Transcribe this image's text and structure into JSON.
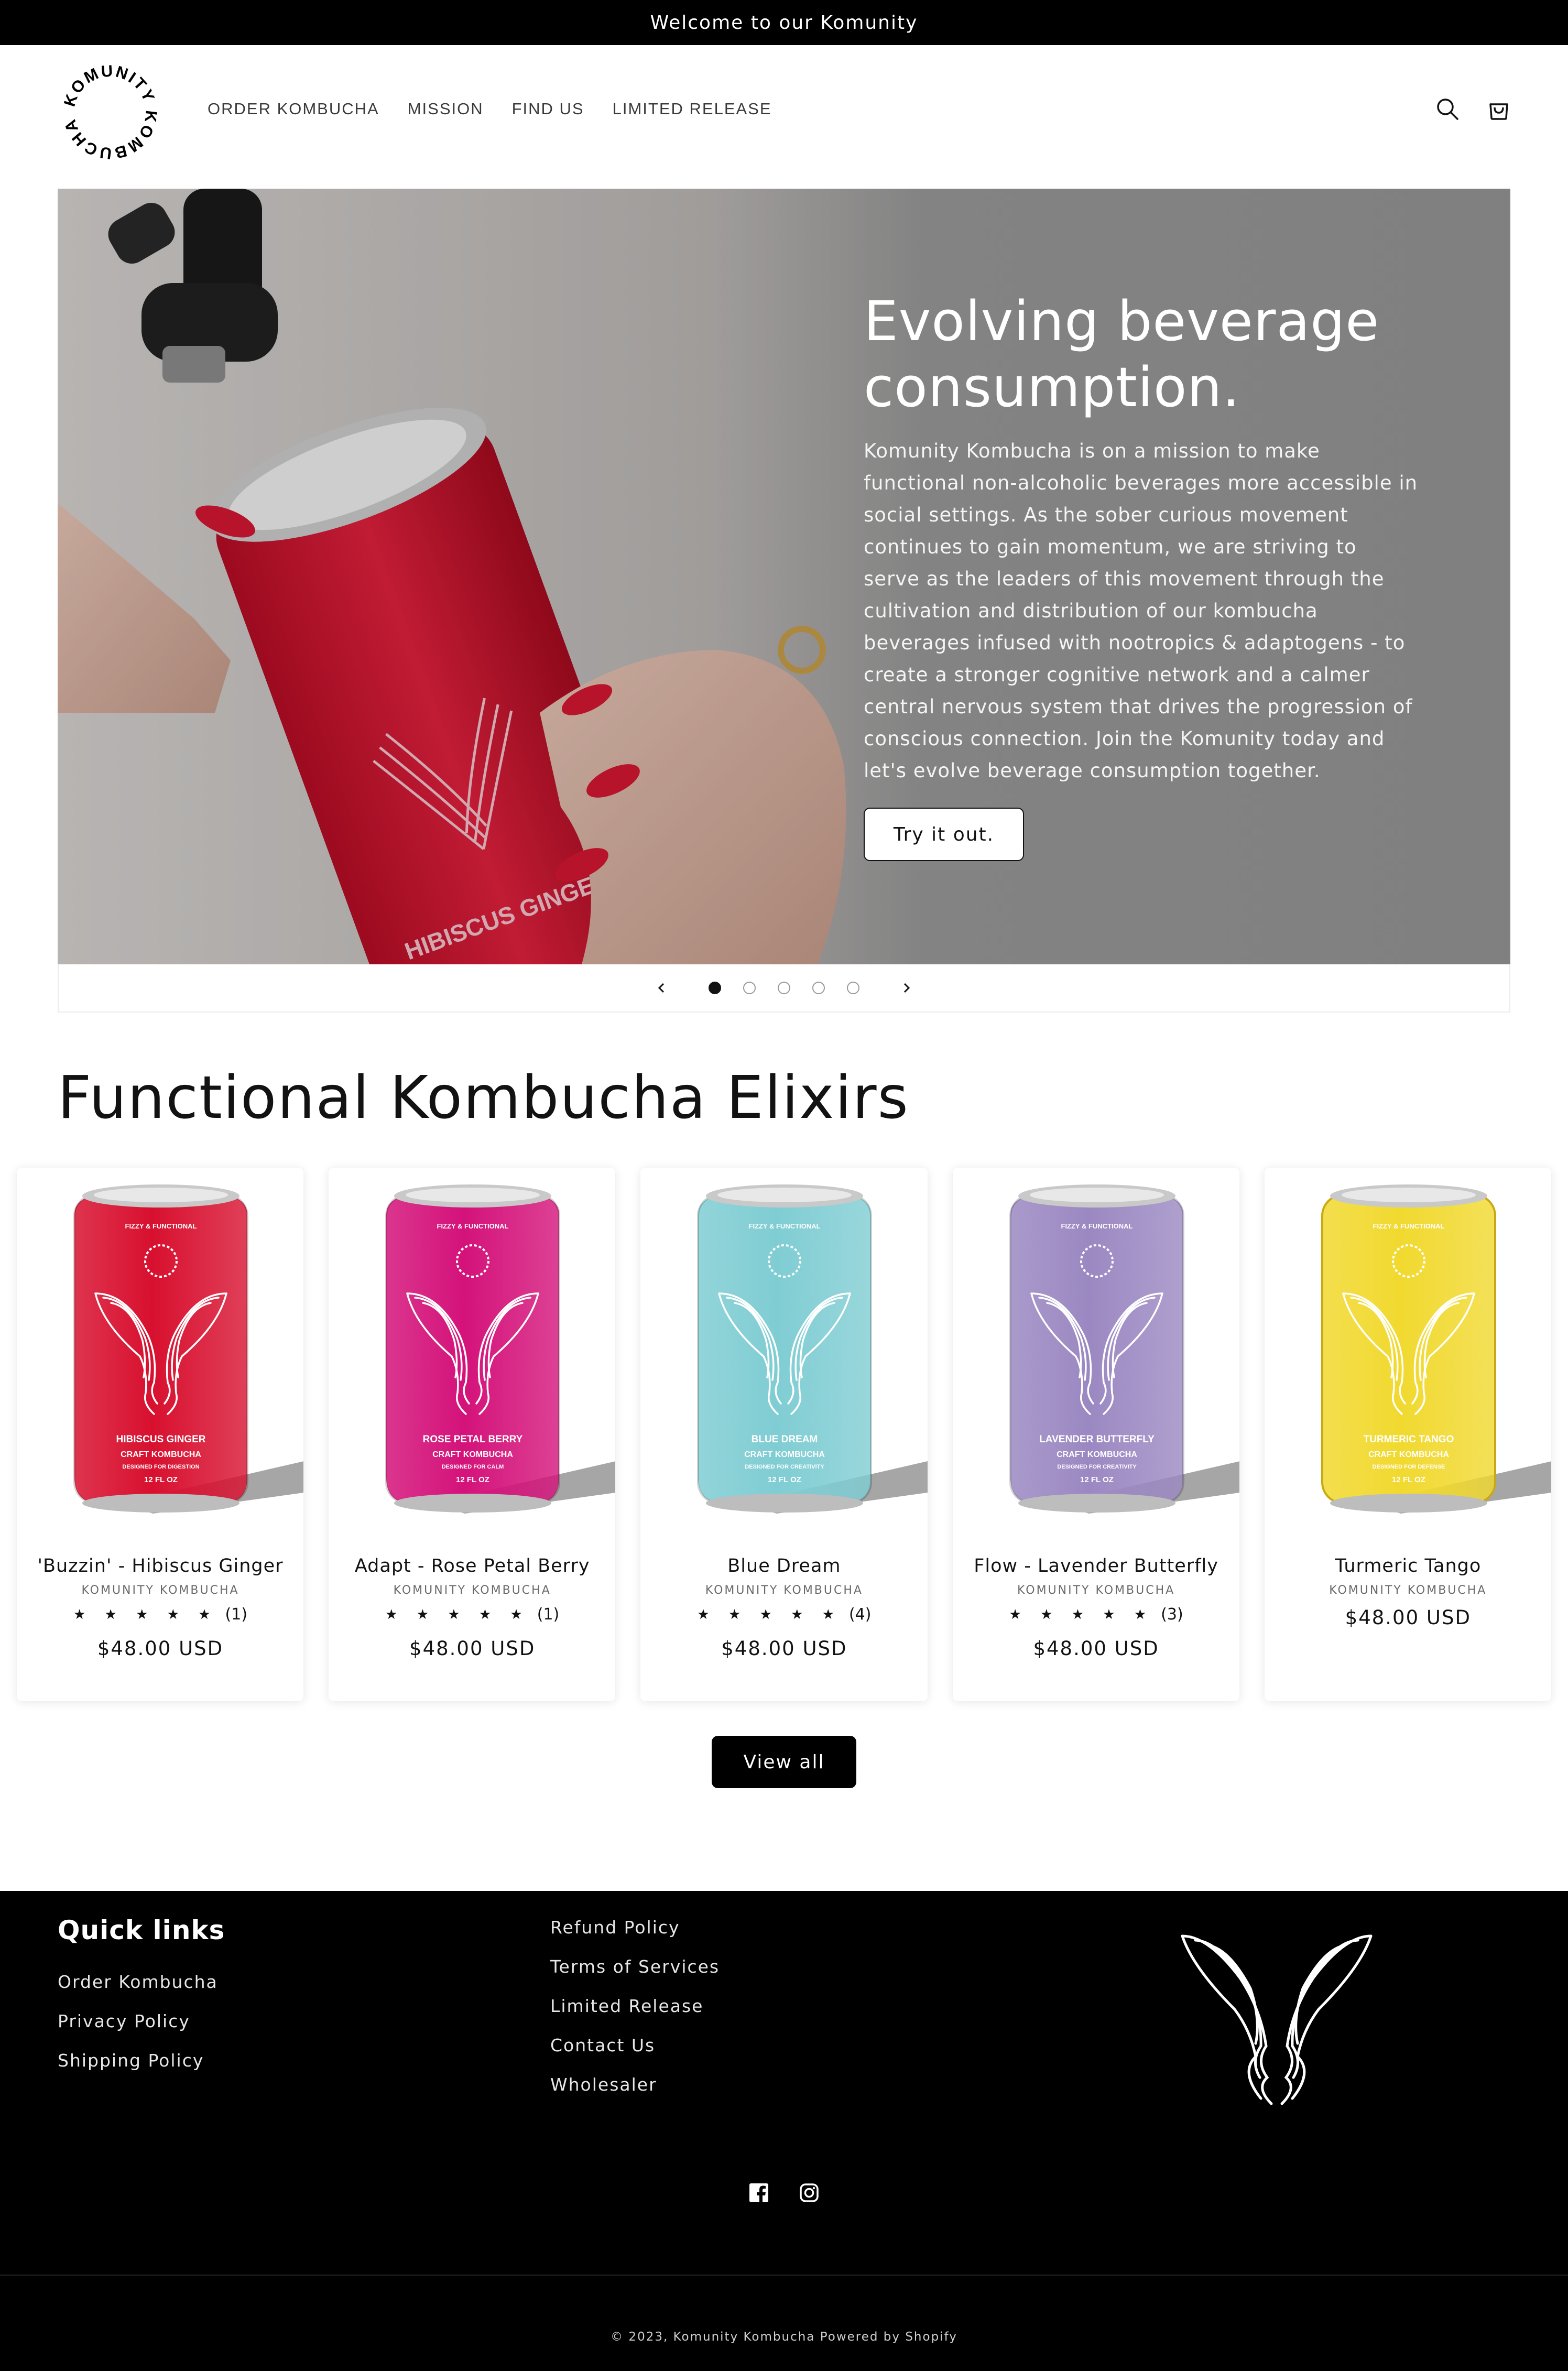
{
  "announcement": "Welcome to our Komunity",
  "header": {
    "logo_text": "KOMUNITY KOMBUCHA",
    "nav": [
      "ORDER KOMBUCHA",
      "MISSION",
      "FIND US",
      "LIMITED RELEASE"
    ],
    "icons": [
      "search-icon",
      "cart-icon"
    ]
  },
  "hero": {
    "title": "Evolving beverage consumption.",
    "body": "Komunity Kombucha is on a mission to make functional non-alcoholic beverages more accessible in social settings. As the sober curious movement continues to gain momentum, we are striving to serve as the leaders of this movement through the cultivation and distribution of our kombucha beverages infused with nootropics & adaptogens - to create a stronger cognitive network and a calmer central nervous system that drives the progression of conscious connection. Join the Komunity today and let's evolve beverage consumption together.",
    "button": "Try it out.",
    "can_label": "HIBISCUS GINGER",
    "slides": 5,
    "active_slide": 1
  },
  "collection": {
    "title": "Functional Kombucha Elixirs",
    "products": [
      {
        "name": "'Buzzin' - Hibiscus Ginger",
        "vendor": "KOMUNITY KOMBUCHA",
        "stars": "★ ★ ★ ★ ★",
        "reviews": "(1)",
        "price": "$48.00 USD",
        "color": "#d8102f",
        "can_top": "FIZZY & FUNCTIONAL",
        "can_flavor": "HIBISCUS GINGER",
        "can_sub": "CRAFT KOMBUCHA",
        "can_tag": "DESIGNED FOR DIGESTION",
        "can_size": "12 FL OZ"
      },
      {
        "name": "Adapt - Rose Petal Berry",
        "vendor": "KOMUNITY KOMBUCHA",
        "stars": "★ ★ ★ ★ ★",
        "reviews": "(1)",
        "price": "$48.00 USD",
        "color": "#d4127a",
        "can_top": "FIZZY & FUNCTIONAL",
        "can_flavor": "ROSE PETAL BERRY",
        "can_sub": "CRAFT KOMBUCHA",
        "can_tag": "DESIGNED FOR CALM",
        "can_size": "12 FL OZ"
      },
      {
        "name": "Blue Dream",
        "vendor": "KOMUNITY KOMBUCHA",
        "stars": "★ ★ ★ ★ ★",
        "reviews": "(4)",
        "price": "$48.00 USD",
        "color": "#7fcdd3",
        "can_top": "FIZZY & FUNCTIONAL",
        "can_flavor": "BLUE DREAM",
        "can_sub": "CRAFT KOMBUCHA",
        "can_tag": "DESIGNED FOR CREATIVITY",
        "can_size": "12 FL OZ"
      },
      {
        "name": "Flow - Lavender Butterfly",
        "vendor": "KOMUNITY KOMBUCHA",
        "stars": "★ ★ ★ ★ ★",
        "reviews": "(3)",
        "price": "$48.00 USD",
        "color": "#9b88c2",
        "can_top": "FIZZY & FUNCTIONAL",
        "can_flavor": "LAVENDER BUTTERFLY",
        "can_sub": "CRAFT KOMBUCHA",
        "can_tag": "DESIGNED FOR CREATIVITY",
        "can_size": "12 FL OZ"
      },
      {
        "name": "Turmeric Tango",
        "vendor": "KOMUNITY KOMBUCHA",
        "stars": "",
        "reviews": "",
        "price": "$48.00 USD",
        "color": "#f1d92f",
        "can_top": "FIZZY & FUNCTIONAL",
        "can_flavor": "TURMERIC TANGO",
        "can_sub": "CRAFT KOMBUCHA",
        "can_tag": "DESIGNED FOR DEFENSE",
        "can_size": "12 FL OZ"
      }
    ],
    "view_all": "View all"
  },
  "footer": {
    "quick_links_title": "Quick links",
    "col1": [
      "Order Kombucha",
      "Privacy Policy",
      "Shipping Policy"
    ],
    "col2": [
      "Refund Policy",
      "Terms of Services",
      "Limited Release",
      "Contact Us",
      "Wholesaler"
    ],
    "social": [
      "facebook-icon",
      "instagram-icon"
    ],
    "copyright": "© 2023, Komunity Kombucha Powered by Shopify"
  }
}
